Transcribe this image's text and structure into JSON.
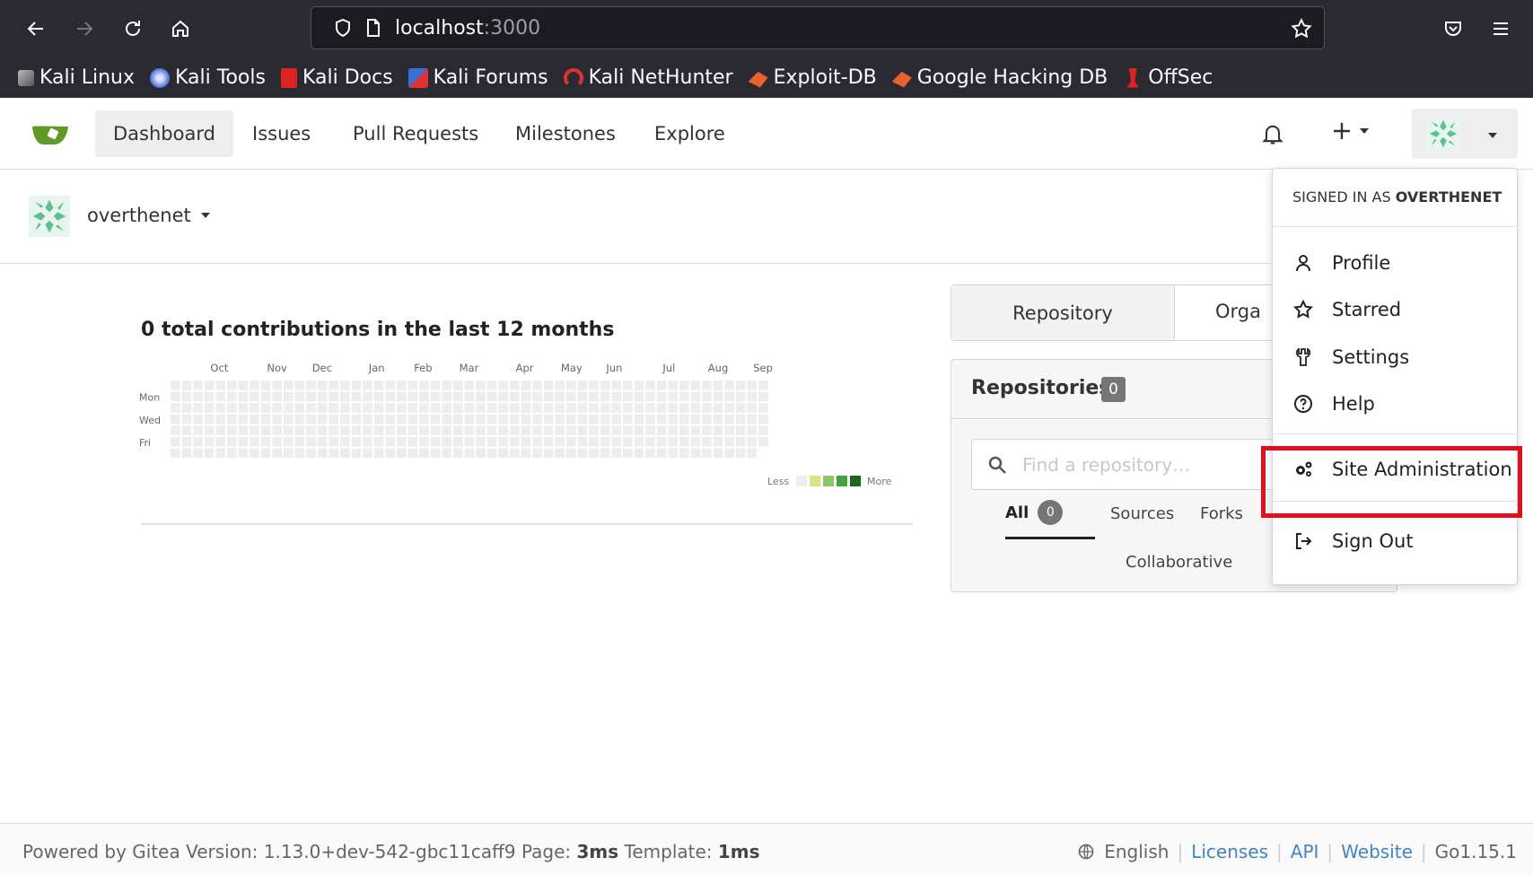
{
  "browser": {
    "url_host": "localhost",
    "url_port": ":3000",
    "bookmarks": [
      "Kali Linux",
      "Kali Tools",
      "Kali Docs",
      "Kali Forums",
      "Kali NetHunter",
      "Exploit-DB",
      "Google Hacking DB",
      "OffSec"
    ]
  },
  "nav": {
    "items": [
      "Dashboard",
      "Issues",
      "Pull Requests",
      "Milestones",
      "Explore"
    ],
    "active": "Dashboard"
  },
  "context": {
    "username": "overthenet"
  },
  "heatmap": {
    "title": "0 total contributions in the last 12 months",
    "months": [
      "Oct",
      "Nov",
      "Dec",
      "Jan",
      "Feb",
      "Mar",
      "Apr",
      "May",
      "Jun",
      "Jul",
      "Aug",
      "Sep"
    ],
    "days": [
      "Mon",
      "Wed",
      "Fri"
    ],
    "legend_less": "Less",
    "legend_more": "More",
    "total": 0,
    "colors": [
      "#ededed",
      "#d6e685",
      "#8cc665",
      "#44a340",
      "#1e6823"
    ]
  },
  "repos": {
    "tab_repository": "Repository",
    "tab_organization": "Orga",
    "title": "Repositories",
    "count": "0",
    "search_placeholder": "Find a repository…",
    "filter_all": "All",
    "filter_all_count": "0",
    "filter_sources": "Sources",
    "filter_forks": "Forks",
    "filter_collaborative": "Collaborative"
  },
  "dropdown": {
    "header_prefix": "SIGNED IN AS",
    "header_user": "OVERTHENET",
    "profile": "Profile",
    "starred": "Starred",
    "settings": "Settings",
    "help": "Help",
    "site_admin": "Site Administration",
    "sign_out": "Sign Out"
  },
  "footer": {
    "powered": "Powered by Gitea Version: 1.13.0+dev-542-gbc11caff9 Page:",
    "page_time": "3ms",
    "template_label": "Template:",
    "template_time": "1ms",
    "language": "English",
    "licenses": "Licenses",
    "api": "API",
    "website": "Website",
    "go_version": "Go1.15.1"
  },
  "colors": {
    "browser_bg": "#2b2a33",
    "gitea_green": "#609926",
    "highlight": "#e0101e"
  }
}
